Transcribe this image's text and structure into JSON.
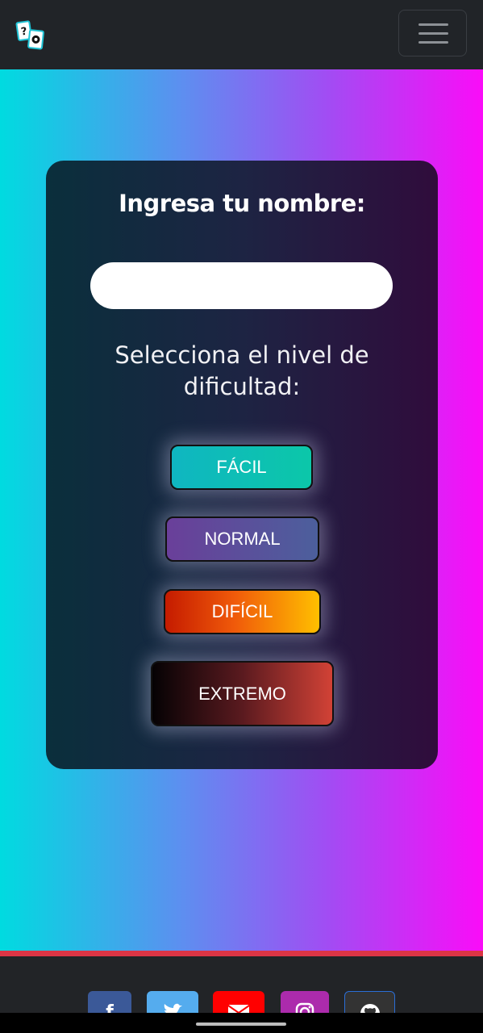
{
  "navbar": {
    "logo_marks": [
      "?",
      "⚙"
    ],
    "menu_icon": "hamburger-icon"
  },
  "card": {
    "title": "Ingresa tu nombre:",
    "name_input": {
      "value": "",
      "placeholder": ""
    },
    "difficulty_prompt": "Selecciona el nivel de dificultad:"
  },
  "levels": [
    {
      "label": "FÁCIL"
    },
    {
      "label": "NORMAL"
    },
    {
      "label": "DIFÍCIL"
    },
    {
      "label": "EXTREMO"
    }
  ],
  "footer": {
    "accent_color": "#dc3545",
    "social": [
      {
        "icon": "facebook-icon",
        "glyph": "f"
      },
      {
        "icon": "twitter-icon",
        "glyph": ""
      },
      {
        "icon": "mail-icon",
        "glyph": ""
      },
      {
        "icon": "instagram-icon",
        "glyph": ""
      },
      {
        "icon": "github-icon",
        "glyph": ""
      }
    ]
  },
  "colors": {
    "gradient_left": "#00dbe0",
    "gradient_right": "#fa0cf8",
    "card_left": "#0a2f3c",
    "card_right": "#300c3c"
  }
}
